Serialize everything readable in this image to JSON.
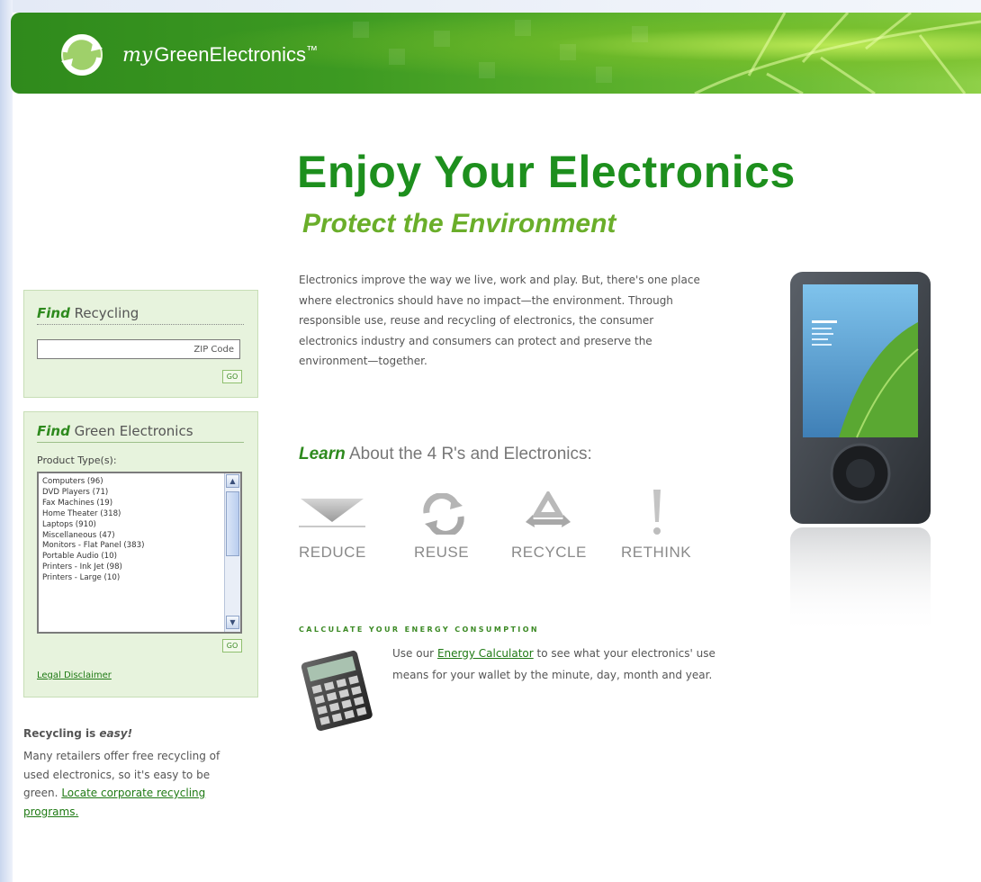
{
  "header": {
    "brand_prefix": "my",
    "brand_name": "GreenElectronics",
    "trademark": "™"
  },
  "hero": {
    "title": "Enjoy Your Electronics",
    "subtitle": "Protect the Environment"
  },
  "intro": "Electronics improve the way we live, work and play. But, there's one place where electronics should have no impact—the environment. Through responsible use, reuse and recycling of electronics, the consumer electronics industry and consumers can protect and preserve the environment—together.",
  "find_recycling": {
    "title_em": "Find",
    "title_rest": " Recycling",
    "zip_placeholder": "ZIP Code",
    "go_label": "GO"
  },
  "find_green": {
    "title_em": "Find",
    "title_rest": " Green Electronics",
    "product_label": "Product Type(s):",
    "options": [
      "Computers (96)",
      "DVD Players (71)",
      "Fax Machines (19)",
      "Home Theater (318)",
      "Laptops (910)",
      "Miscellaneous (47)",
      "Monitors - Flat Panel (383)",
      "Portable Audio (10)",
      "Printers - Ink Jet (98)",
      "Printers - Large (10)"
    ],
    "go_label": "GO",
    "legal": "Legal Disclaimer"
  },
  "recycling_easy": {
    "title": "Recycling is ",
    "title_em": "easy!",
    "text": "Many retailers offer free recycling of used electronics, so it's easy to be green.",
    "link": "Locate corporate recycling programs."
  },
  "learn": {
    "em": "Learn",
    "rest": " About the 4 R's and Electronics:",
    "items": [
      {
        "label": "REDUCE",
        "icon": "down-arrow-icon"
      },
      {
        "label": "REUSE",
        "icon": "reuse-arrows-icon"
      },
      {
        "label": "RECYCLE",
        "icon": "recycle-icon"
      },
      {
        "label": "RETHINK",
        "icon": "exclamation-icon"
      }
    ]
  },
  "calculator": {
    "heading": "CALCULATE YOUR ENERGY CONSUMPTION",
    "pre": "Use our ",
    "link": "Energy Calculator",
    "post": " to see what your electronics' use means for your wallet by the minute, day, month and year."
  },
  "colors": {
    "brand_green": "#1d8f1d",
    "light_green": "#6aae2a",
    "box_bg": "#e7f3dd"
  }
}
